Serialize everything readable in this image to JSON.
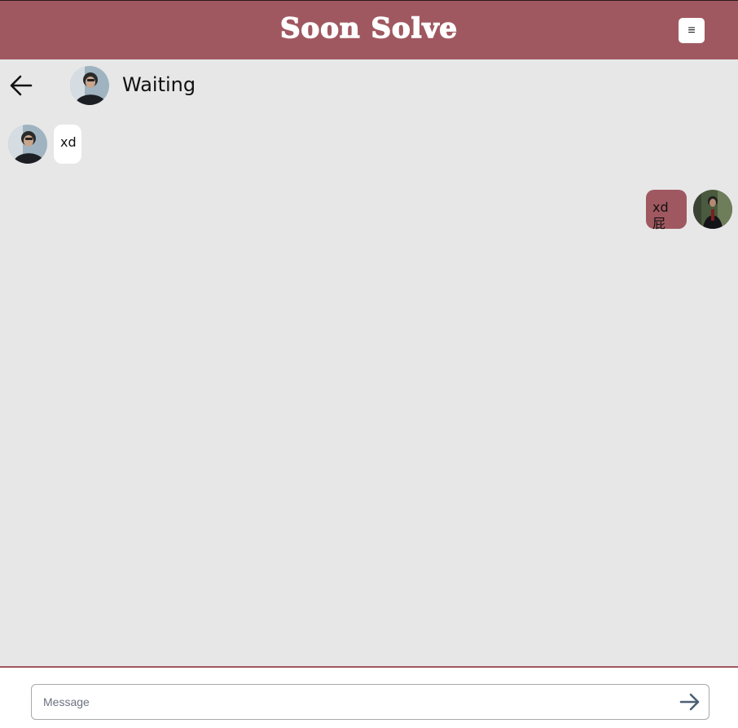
{
  "app": {
    "brand": "Soon Solve",
    "menu_glyph": "≡"
  },
  "chat": {
    "contact_name": "Waiting",
    "messages": [
      {
        "direction": "incoming",
        "text": "xd"
      },
      {
        "direction": "outgoing",
        "text": "xd屁"
      }
    ]
  },
  "composer": {
    "placeholder": "Message",
    "value": ""
  },
  "colors": {
    "brand": "#a05860",
    "background": "#e7e7e7",
    "incoming_bubble": "#ffffff",
    "outgoing_bubble": "#a05860"
  },
  "icons": {
    "menu": "menu-icon",
    "back": "arrow-left-icon",
    "send": "arrow-right-icon"
  }
}
